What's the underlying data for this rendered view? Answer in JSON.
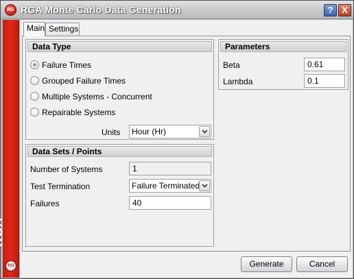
{
  "window": {
    "title": "RGA Monte Carlo Data Generation",
    "icon": "rga-logo-icon",
    "help_label": "?",
    "close_label": "X"
  },
  "sidebar": {
    "label": "RGA"
  },
  "tabs": [
    {
      "label": "Main",
      "selected": true
    },
    {
      "label": "Settings",
      "selected": false
    }
  ],
  "data_type": {
    "header": "Data Type",
    "options": [
      {
        "label": "Failure Times",
        "checked": true
      },
      {
        "label": "Grouped Failure Times",
        "checked": false
      },
      {
        "label": "Multiple Systems - Concurrent",
        "checked": false
      },
      {
        "label": "Repairable Systems",
        "checked": false
      }
    ],
    "units_label": "Units",
    "units_value": "Hour (Hr)"
  },
  "data_sets": {
    "header": "Data Sets / Points",
    "systems_label": "Number of Systems",
    "systems_value": "1",
    "termination_label": "Test Termination",
    "termination_value": "Failure Terminated",
    "failures_label": "Failures",
    "failures_value": "40"
  },
  "parameters": {
    "header": "Parameters",
    "beta_label": "Beta",
    "beta_value": "0.61",
    "lambda_label": "Lambda",
    "lambda_value": "0.1"
  },
  "buttons": {
    "generate": "Generate",
    "cancel": "Cancel"
  },
  "colors": {
    "brand_red": "#d4281a",
    "panel": "#f0f0f0"
  }
}
